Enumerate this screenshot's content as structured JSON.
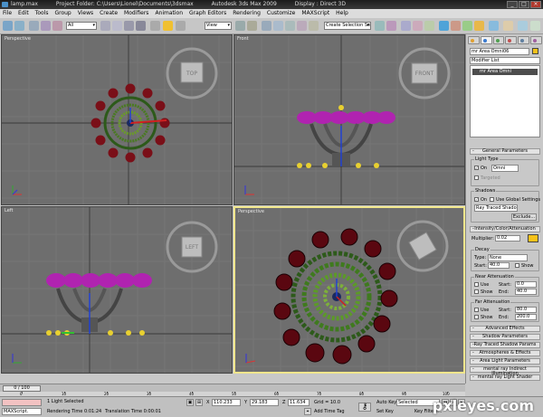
{
  "window": {
    "file": "lamp.max",
    "folder": "Project Folder: C:\\Users\\Lionel\\Documents\\3dsmax",
    "app": "Autodesk 3ds Max 2009",
    "display": "Display : Direct 3D"
  },
  "menu": [
    "File",
    "Edit",
    "Tools",
    "Group",
    "Views",
    "Create",
    "Modifiers",
    "Animation",
    "Graph Editors",
    "Rendering",
    "Customize",
    "MAXScript",
    "Help"
  ],
  "toolbar": {
    "selection_filter": "All",
    "ref_coord": "View",
    "named_selection": "Create Selection Set"
  },
  "viewports": {
    "top": "Perspective",
    "front": "Front",
    "left": "Left",
    "persp": "Perspective",
    "cube_top": "TOP",
    "cube_front": "FRONT",
    "cube_left": "LEFT"
  },
  "command_panel": {
    "object_name": "mr Area Omni06",
    "modifier_list": "Modifier List",
    "stack_item": "mr Area Omni",
    "object_color": "#f6c21a",
    "general": {
      "title": "General Parameters",
      "light_type_group": "Light Type",
      "on_label": "On",
      "type": "Omni",
      "targeted": "Targeted",
      "shadows_group": "Shadows",
      "use_global": "Use Global Settings",
      "shadow_type": "Ray Traced Shadows",
      "exclude": "Exclude..."
    },
    "intensity": {
      "title": "Intensity/Color/Attenuation",
      "multiplier_label": "Multiplier:",
      "multiplier": "0.02",
      "light_color": "#f6c21a",
      "decay_group": "Decay",
      "type_label": "Type:",
      "type": "None",
      "start_label": "Start:",
      "start": "40.0",
      "show": "Show",
      "near_group": "Near Attenuation",
      "use": "Use",
      "near_start": "0.0",
      "end_label": "End:",
      "near_end": "40.0",
      "far_group": "Far Attenuation",
      "far_start": "80.0",
      "far_end": "200.0"
    },
    "rollouts": [
      "Advanced Effects",
      "Shadow Parameters",
      "Ray Traced Shadow Params",
      "Atmospheres & Effects",
      "Area Light Parameters",
      "mental ray Indirect Illumination",
      "mental ray Light Shader"
    ]
  },
  "timeline": {
    "frame": "0 / 100",
    "ticks": [
      "0",
      "10",
      "20",
      "30",
      "40",
      "50",
      "60",
      "70",
      "80",
      "90",
      "100"
    ]
  },
  "status": {
    "maxscript": "MAXScript.",
    "selected": "1 Light Selected",
    "rendering_time": "Rendering Time  0:01:24",
    "translation_time": "Translation Time  0:00:01",
    "x_label": "X",
    "x": "110.233",
    "y_label": "Y",
    "y": "29.183",
    "z_label": "Z",
    "z": "11.634",
    "grid": "Grid = 10.0",
    "add_time_tag": "Add Time Tag",
    "auto_key": "Auto Key",
    "set_key": "Set Key",
    "key_selected": "Selected",
    "key_filters": "Key Filters...",
    "frame_field": "0"
  },
  "watermark": "pxleyes.com"
}
